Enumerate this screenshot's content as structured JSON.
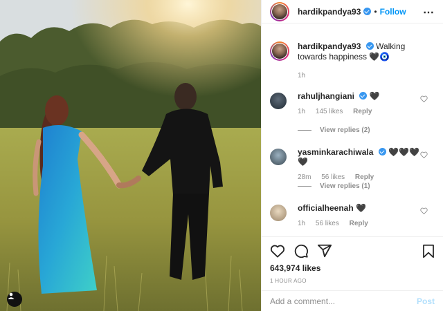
{
  "header": {
    "username": "hardikpandya93",
    "separator": "•",
    "follow_label": "Follow",
    "more_icon": "more-horizontal-icon"
  },
  "caption": {
    "username": "hardikpandya93",
    "text": "Walking towards happiness 🖤🧿",
    "time": "1h"
  },
  "comments": [
    {
      "username": "rahuljhangiani",
      "text": "🖤",
      "time": "1h",
      "likes": "145 likes",
      "reply_label": "Reply",
      "view_replies": "View replies (2)"
    },
    {
      "username": "yasminkarachiwala",
      "text": "🖤🖤🖤🖤",
      "time": "28m",
      "likes": "56 likes",
      "reply_label": "Reply",
      "view_replies": "View replies (1)"
    },
    {
      "username": "officialheenah",
      "text": "🖤",
      "time": "1h",
      "likes": "56 likes",
      "reply_label": "Reply"
    }
  ],
  "post": {
    "likes": "643,974 likes",
    "timestamp": "1 HOUR AGO"
  },
  "add_comment": {
    "placeholder": "Add a comment...",
    "post_label": "Post"
  },
  "colors": {
    "link": "#0095f6",
    "verified": "#3897f0",
    "muted": "#8e8e8e",
    "post_disabled": "#b2dffc"
  },
  "icons": [
    "heart-icon",
    "comment-icon",
    "share-icon",
    "bookmark-icon",
    "verified-icon",
    "user-tag-icon"
  ]
}
